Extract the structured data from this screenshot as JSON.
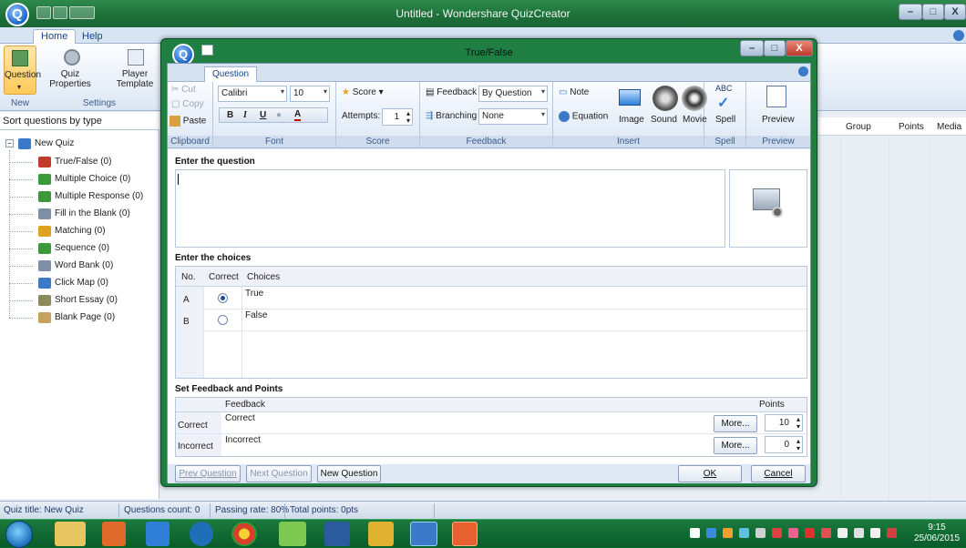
{
  "window": {
    "title": "Untitled - Wondershare QuizCreator"
  },
  "window_controls": {
    "minimize": "–",
    "maximize": "□",
    "close": "X"
  },
  "main_tabs": [
    {
      "label": "Home"
    },
    {
      "label": "Help"
    }
  ],
  "main_ribbon": {
    "buttons": [
      {
        "label": "Question"
      },
      {
        "label": "Quiz Properties"
      },
      {
        "label": "Player Template"
      }
    ],
    "groups": [
      {
        "label": "New"
      },
      {
        "label": "Settings"
      }
    ]
  },
  "left_panel": {
    "header": "Sort questions by type",
    "root": "New Quiz",
    "items": [
      {
        "label": "True/False  (0)",
        "color": "#c23a2a"
      },
      {
        "label": "Multiple Choice  (0)",
        "color": "#3a9a3a"
      },
      {
        "label": "Multiple Response  (0)",
        "color": "#3a9a3a"
      },
      {
        "label": "Fill in the Blank  (0)",
        "color": "#7f8fa8"
      },
      {
        "label": "Matching  (0)",
        "color": "#e0a020"
      },
      {
        "label": "Sequence  (0)",
        "color": "#3a9a3a"
      },
      {
        "label": "Word Bank  (0)",
        "color": "#7f8fa8"
      },
      {
        "label": "Click Map  (0)",
        "color": "#3a7ac8"
      },
      {
        "label": "Short Essay  (0)",
        "color": "#8a8a5a"
      },
      {
        "label": "Blank Page  (0)",
        "color": "#c8a060"
      }
    ]
  },
  "right_panel": {
    "columns": [
      "Group",
      "Points",
      "Media"
    ]
  },
  "statusbar": {
    "quiz_title": "Quiz title: New Quiz",
    "questions_count": "Questions count: 0",
    "passing_rate": "Passing rate: 80%",
    "total_points": "Total points: 0pts"
  },
  "taskbar": {
    "time": "9:15",
    "date": "25/06/2015"
  },
  "dialog": {
    "title": "True/False",
    "tab": "Question",
    "clipboard": {
      "cut": "Cut",
      "copy": "Copy",
      "paste": "Paste",
      "label": "Clipboard"
    },
    "font": {
      "family": "Calibri",
      "size": "10",
      "bold": "B",
      "italic": "I",
      "underline": "U",
      "color": "A",
      "label": "Font"
    },
    "score": {
      "score": "Score",
      "attempts_label": "Attempts:",
      "attempts_value": "1",
      "label": "Score"
    },
    "feedback": {
      "feedback_label": "Feedback",
      "feedback_value": "By Question",
      "branching_label": "Branching",
      "branching_value": "None",
      "label": "Feedback"
    },
    "insert": {
      "note": "Note",
      "equation": "Equation",
      "image": "Image",
      "sound": "Sound",
      "movie": "Movie",
      "label": "Insert"
    },
    "spell": {
      "button": "Spell",
      "abc": "ABC",
      "label": "Spell"
    },
    "preview": {
      "button": "Preview",
      "label": "Preview"
    },
    "question_section": "Enter the question",
    "choices_section": "Enter the choices",
    "choices_headers": {
      "no": "No.",
      "correct": "Correct",
      "choices": "Choices"
    },
    "choices": [
      {
        "no": "A",
        "text": "True",
        "correct": true
      },
      {
        "no": "B",
        "text": "False",
        "correct": false
      }
    ],
    "feedback_section": "Set Feedback and Points",
    "feedback_headers": {
      "feedback": "Feedback",
      "points": "Points"
    },
    "feedback_rows": [
      {
        "label": "Correct",
        "text": "Correct",
        "more": "More...",
        "points": "10"
      },
      {
        "label": "Incorrect",
        "text": "Incorrect",
        "more": "More...",
        "points": "0"
      }
    ],
    "footer": {
      "prev": "Prev Question",
      "next": "Next Question",
      "new": "New Question",
      "ok": "OK",
      "cancel": "Cancel"
    }
  }
}
